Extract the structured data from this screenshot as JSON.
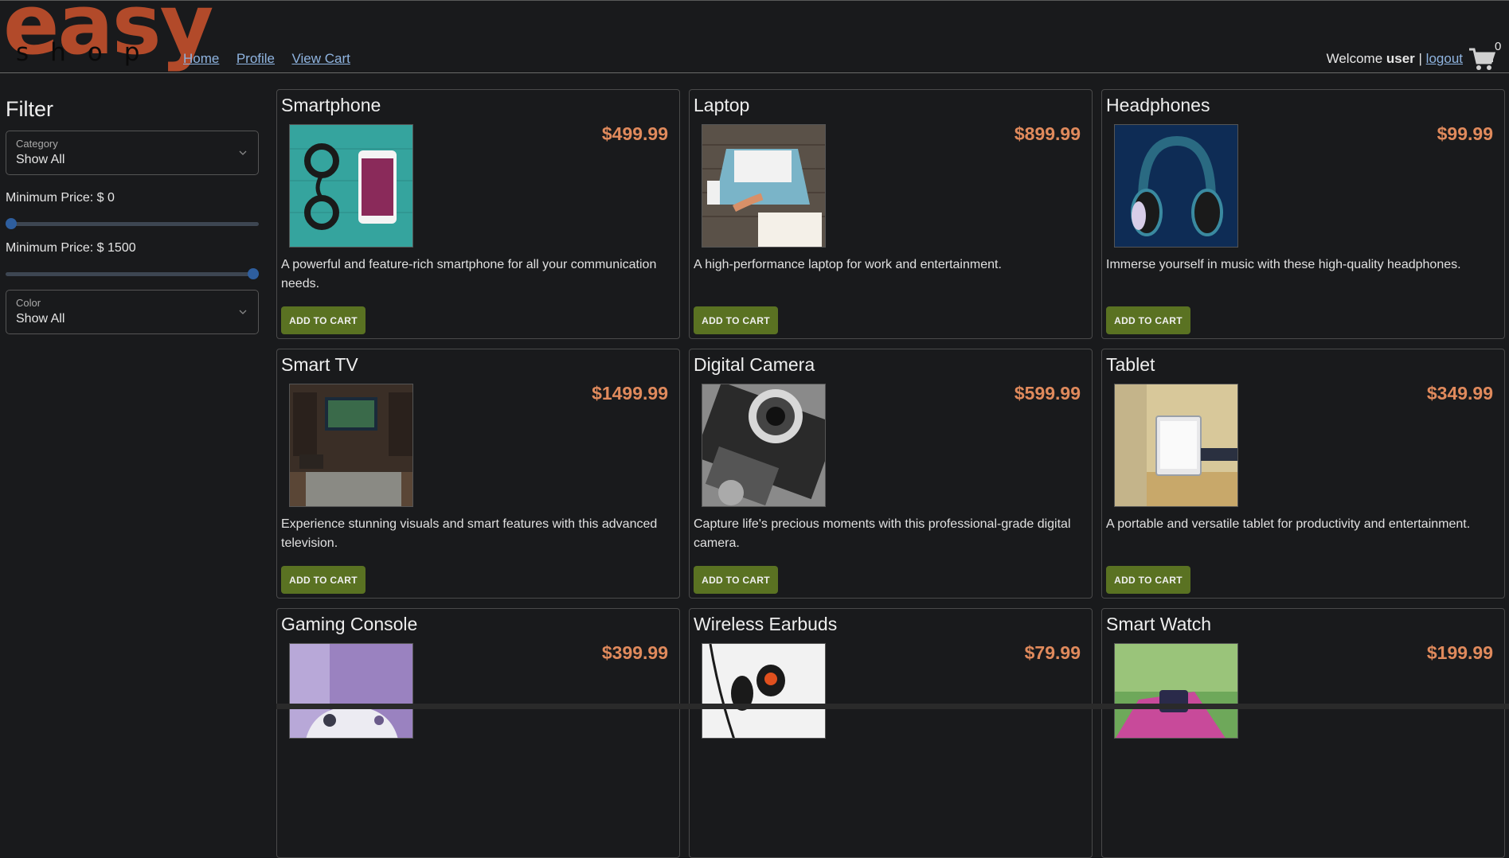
{
  "logo": {
    "main": "easy",
    "sub": "shop"
  },
  "nav": [
    {
      "label": "Home"
    },
    {
      "label": "Profile"
    },
    {
      "label": "View Cart"
    }
  ],
  "user": {
    "welcome": "Welcome ",
    "name": "user",
    "separator": " | ",
    "logout": "logout"
  },
  "cart": {
    "count": "0",
    "icon": "cart-icon"
  },
  "filter": {
    "title": "Filter",
    "category": {
      "label": "Category",
      "value": "Show All"
    },
    "min_price": {
      "label": "Minimum Price: $ 0",
      "level": 0
    },
    "max_price": {
      "label": "Minimum Price: $ 1500",
      "level": 1
    },
    "color": {
      "label": "Color",
      "value": "Show All"
    }
  },
  "products": [
    {
      "name": "Smartphone",
      "price": "$499.99",
      "desc": "A powerful and feature-rich smartphone for all your communication needs.",
      "button": "ADD TO CART"
    },
    {
      "name": "Laptop",
      "price": "$899.99",
      "desc": "A high-performance laptop for work and entertainment.",
      "button": "ADD TO CART"
    },
    {
      "name": "Headphones",
      "price": "$99.99",
      "desc": "Immerse yourself in music with these high-quality headphones.",
      "button": "ADD TO CART"
    },
    {
      "name": "Smart TV",
      "price": "$1499.99",
      "desc": "Experience stunning visuals and smart features with this advanced television.",
      "button": "ADD TO CART"
    },
    {
      "name": "Digital Camera",
      "price": "$599.99",
      "desc": "Capture life's precious moments with this professional-grade digital camera.",
      "button": "ADD TO CART"
    },
    {
      "name": "Tablet",
      "price": "$349.99",
      "desc": "A portable and versatile tablet for productivity and entertainment.",
      "button": "ADD TO CART"
    },
    {
      "name": "Gaming Console",
      "price": "$399.99",
      "desc": "",
      "button": ""
    },
    {
      "name": "Wireless Earbuds",
      "price": "$79.99",
      "desc": "",
      "button": ""
    },
    {
      "name": "Smart Watch",
      "price": "$199.99",
      "desc": "",
      "button": ""
    }
  ],
  "colors": {
    "accent": "#b24a2a",
    "price": "#e08a5c",
    "button": "#5a7222",
    "link": "#8fb4e0",
    "slider": "#2e5e9e"
  }
}
